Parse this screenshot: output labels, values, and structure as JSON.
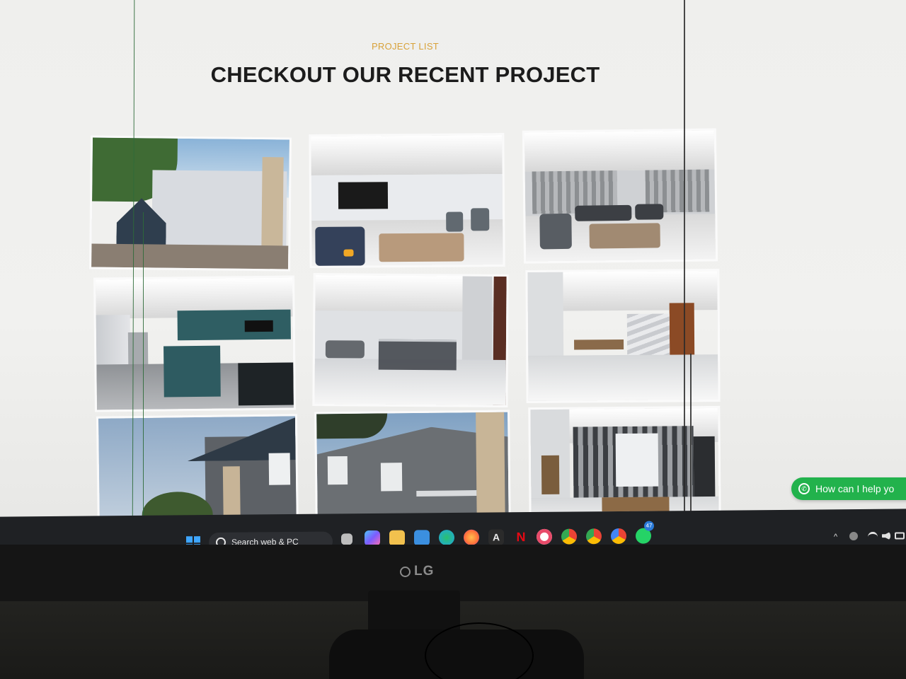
{
  "page": {
    "eyebrow": "PROJECT LIST",
    "heading": "CHECKOUT OUR RECENT PROJECT"
  },
  "colors": {
    "eyebrow": "#d8a23a",
    "heading": "#1c1c1c",
    "whatsapp": "#22b24c",
    "taskbar": "#1f2124"
  },
  "projects": [
    {
      "name": "exterior-house-front"
    },
    {
      "name": "living-room-tv"
    },
    {
      "name": "living-room-sofas"
    },
    {
      "name": "kitchen-teal"
    },
    {
      "name": "hallway-glass-rail"
    },
    {
      "name": "dining-staircase"
    },
    {
      "name": "exterior-roof-sky"
    },
    {
      "name": "exterior-balcony"
    },
    {
      "name": "dining-room-curtains"
    }
  ],
  "whatsapp_chip": {
    "label": "How can I help yo",
    "icon": "whatsapp-icon"
  },
  "taskbar": {
    "search_label": "Search web & PC",
    "start_icon": "windows-start-icon",
    "apps": [
      {
        "name": "task-view-icon",
        "color": "#bdbdbd"
      },
      {
        "name": "copilot-icon",
        "color": "#7c5cff"
      },
      {
        "name": "file-explorer-icon",
        "color": "#f2c14e"
      },
      {
        "name": "store-icon",
        "color": "#3b8fe0"
      },
      {
        "name": "edge-icon",
        "color": "#1fa6e0"
      },
      {
        "name": "firefox-icon",
        "color": "#ff7139"
      },
      {
        "name": "adobe-icon",
        "color": "#e8e8e8"
      },
      {
        "name": "netflix-icon",
        "color": "#e50914"
      },
      {
        "name": "record-icon",
        "color": "#ffffff"
      },
      {
        "name": "chrome-icon",
        "color": "#34a853"
      },
      {
        "name": "chrome-profile-m-icon",
        "color": "#fbbc05"
      },
      {
        "name": "chrome-profile-e-icon",
        "color": "#4285f4"
      },
      {
        "name": "whatsapp-taskbar-icon",
        "color": "#25d366",
        "badge": "47"
      }
    ],
    "tray": {
      "chevron": "^",
      "badge": "whatsapp-tray-badge"
    }
  },
  "monitor": {
    "brand": "LG"
  }
}
